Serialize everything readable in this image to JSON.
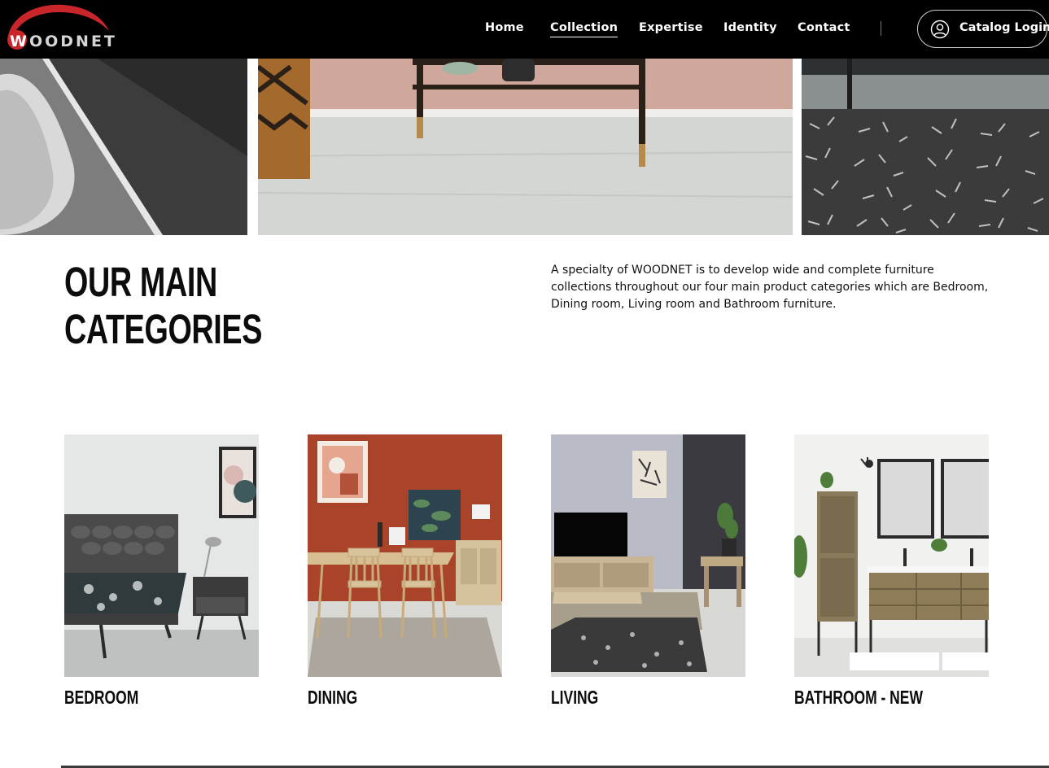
{
  "brand": {
    "logo_text": "WOODNET",
    "logo_first": "W",
    "logo_rest": "OODNET",
    "accent_color": "#c8262b"
  },
  "nav": {
    "items": [
      {
        "label": "Home",
        "active": false
      },
      {
        "label": "Collection",
        "active": true
      },
      {
        "label": "Expertise",
        "active": false
      },
      {
        "label": "Identity",
        "active": false
      },
      {
        "label": "Contact",
        "active": false
      }
    ],
    "catalog_login": {
      "label": "Catalog Login",
      "icon": "user-circle-icon"
    }
  },
  "hero": {
    "panels": [
      {
        "name": "chair-closeup-photo"
      },
      {
        "name": "console-table-photo"
      },
      {
        "name": "shag-rug-photo"
      }
    ]
  },
  "section": {
    "title_line1": "OUR MAIN",
    "title_line2": "CATEGORIES",
    "intro": "A specialty of WOODNET is to develop wide and complete furniture collections throughout our four main product categories which are Bedroom, Dining room, Living room and Bathroom furniture."
  },
  "categories": [
    {
      "label": "BEDROOM",
      "image": "bedroom-photo"
    },
    {
      "label": "DINING",
      "image": "dining-photo"
    },
    {
      "label": "LIVING",
      "image": "living-photo"
    },
    {
      "label": "BATHROOM - NEW",
      "image": "bathroom-photo"
    }
  ]
}
